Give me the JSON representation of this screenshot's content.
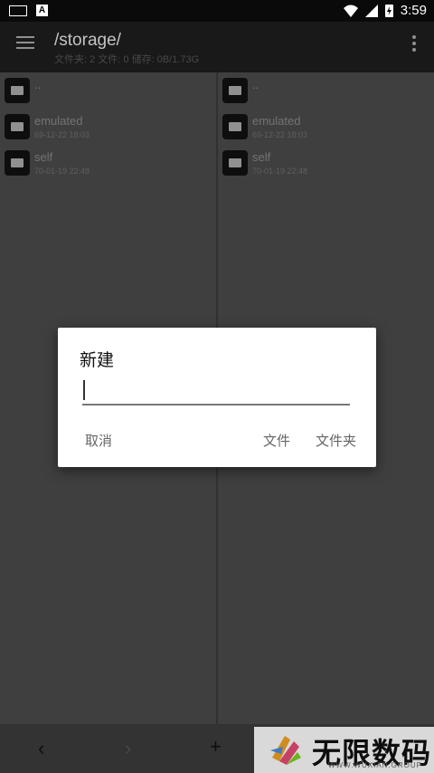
{
  "statusbar": {
    "time": "3:59"
  },
  "appbar": {
    "path": "/storage/",
    "subtitle": "文件夹: 2  文件: 0  储存: 0B/1.73G"
  },
  "left_pane": {
    "items": [
      {
        "name": "..",
        "date": ""
      },
      {
        "name": "emulated",
        "date": "69-12-22 18:03"
      },
      {
        "name": "self",
        "date": "70-01-19 22:48"
      }
    ]
  },
  "right_pane": {
    "items": [
      {
        "name": "..",
        "date": ""
      },
      {
        "name": "emulated",
        "date": "69-12-22 18:03"
      },
      {
        "name": "self",
        "date": "70-01-19 22:48"
      }
    ]
  },
  "bottombar": {
    "back": "‹",
    "forward": "›",
    "add": "+"
  },
  "watermark": {
    "brand": "无限数码",
    "sub": "WWW.WUXIAN.GROUP"
  },
  "dialog": {
    "title": "新建",
    "input_value": "",
    "cancel_label": "取消",
    "file_label": "文件",
    "folder_label": "文件夹"
  }
}
